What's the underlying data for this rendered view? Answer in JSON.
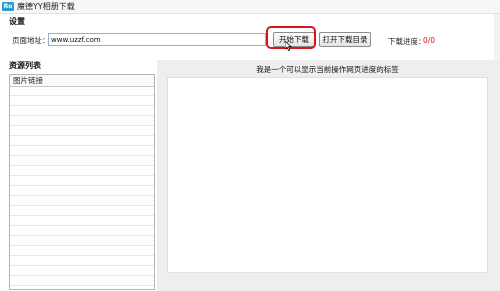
{
  "window": {
    "title": "魔德YY相册下载",
    "icon_text": "Ro"
  },
  "settings": {
    "header": "设置",
    "url_label": "页面地址：",
    "url_value": "www.uzzf.com",
    "start_button": "开始下载",
    "open_dir_button": "打开下载目录",
    "progress_label": "下载进度：",
    "progress_value": "0/0",
    "progress_color": "#d9141c"
  },
  "resources": {
    "header": "资源列表",
    "column_header": "图片链接"
  },
  "status": {
    "label": "我是一个可以显示当前操作网页进度的标签"
  },
  "highlight": {
    "color": "#d9141c"
  }
}
